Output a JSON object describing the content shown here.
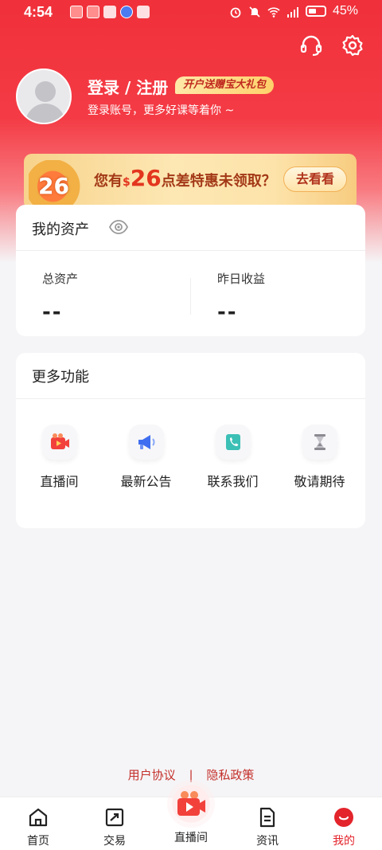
{
  "status_bar": {
    "time": "4:54",
    "battery": "45%"
  },
  "header": {
    "login_title": "登录 / 注册",
    "promo_tag": "开户送赠宝大礼包",
    "login_subtitle": "登录账号，更多好课等着你 ~"
  },
  "banner": {
    "badge_number": "26",
    "text_prefix": "您有",
    "currency": "$",
    "amount": "26",
    "text_suffix": "点差特惠未领取？",
    "button_label": "去看看"
  },
  "assets": {
    "title": "我的资产",
    "total_label": "总资产",
    "total_value": "--",
    "yesterday_label": "昨日收益",
    "yesterday_value": "--"
  },
  "more_functions": {
    "title": "更多功能",
    "items": [
      {
        "label": "直播间",
        "icon": "live-video-icon"
      },
      {
        "label": "最新公告",
        "icon": "megaphone-icon"
      },
      {
        "label": "联系我们",
        "icon": "phone-icon"
      },
      {
        "label": "敬请期待",
        "icon": "hourglass-icon"
      }
    ]
  },
  "footer": {
    "user_agreement": "用户协议",
    "separator": "|",
    "privacy_policy": "隐私政策"
  },
  "tabbar": {
    "items": [
      {
        "label": "首页",
        "icon": "home-icon"
      },
      {
        "label": "交易",
        "icon": "trade-icon"
      },
      {
        "label": "直播间",
        "icon": "live-icon"
      },
      {
        "label": "资讯",
        "icon": "news-icon"
      },
      {
        "label": "我的",
        "icon": "profile-icon"
      }
    ],
    "active_index": 4
  },
  "colors": {
    "brand_red": "#e3242b",
    "header_red": "#f0303a"
  }
}
